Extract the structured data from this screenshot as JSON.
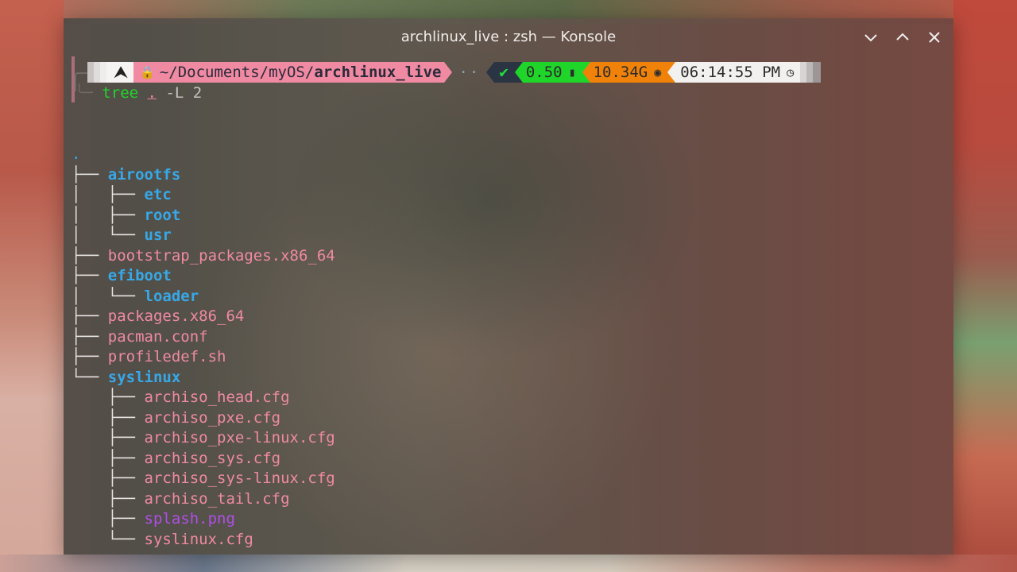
{
  "window": {
    "title": "archlinux_live : zsh — Konsole",
    "buttons": [
      "minimize",
      "maximize",
      "close"
    ]
  },
  "prompt": {
    "os_icon": "⮝",
    "lock_icon": "🔒",
    "path_prefix": "~/Documents/myOS/",
    "path_current": "archlinux_live",
    "dots": "··",
    "status": "✔",
    "load": "0.50",
    "load_icon": "📶",
    "memory": "10.34G",
    "memory_icon": "🎛",
    "time": "06:14:55 PM",
    "time_icon": "⏲"
  },
  "command": {
    "prefix": "╰─ ",
    "name": "tree",
    "arg": ".",
    "flags": "-L 2"
  },
  "tree": [
    {
      "branch": "",
      "name": ".",
      "type": "dot"
    },
    {
      "branch": "├── ",
      "name": "airootfs",
      "type": "dir"
    },
    {
      "branch": "│   ├── ",
      "name": "etc",
      "type": "dir"
    },
    {
      "branch": "│   ├── ",
      "name": "root",
      "type": "dir"
    },
    {
      "branch": "│   └── ",
      "name": "usr",
      "type": "dir"
    },
    {
      "branch": "├── ",
      "name": "bootstrap_packages.x86_64",
      "type": "file"
    },
    {
      "branch": "├── ",
      "name": "efiboot",
      "type": "dir"
    },
    {
      "branch": "│   └── ",
      "name": "loader",
      "type": "dir"
    },
    {
      "branch": "├── ",
      "name": "packages.x86_64",
      "type": "file"
    },
    {
      "branch": "├── ",
      "name": "pacman.conf",
      "type": "file"
    },
    {
      "branch": "├── ",
      "name": "profiledef.sh",
      "type": "file"
    },
    {
      "branch": "└── ",
      "name": "syslinux",
      "type": "dir"
    },
    {
      "branch": "    ├── ",
      "name": "archiso_head.cfg",
      "type": "file"
    },
    {
      "branch": "    ├── ",
      "name": "archiso_pxe.cfg",
      "type": "file"
    },
    {
      "branch": "    ├── ",
      "name": "archiso_pxe-linux.cfg",
      "type": "file"
    },
    {
      "branch": "    ├── ",
      "name": "archiso_sys.cfg",
      "type": "file"
    },
    {
      "branch": "    ├── ",
      "name": "archiso_sys-linux.cfg",
      "type": "file"
    },
    {
      "branch": "    ├── ",
      "name": "archiso_tail.cfg",
      "type": "file"
    },
    {
      "branch": "    ├── ",
      "name": "splash.png",
      "type": "img"
    },
    {
      "branch": "    └── ",
      "name": "syslinux.cfg",
      "type": "file"
    }
  ],
  "colors": {
    "dir": "#37a8e8",
    "file": "#f08aa2",
    "image": "#b04ee8",
    "ok": "#1fd52a",
    "mem": "#f0820a"
  }
}
